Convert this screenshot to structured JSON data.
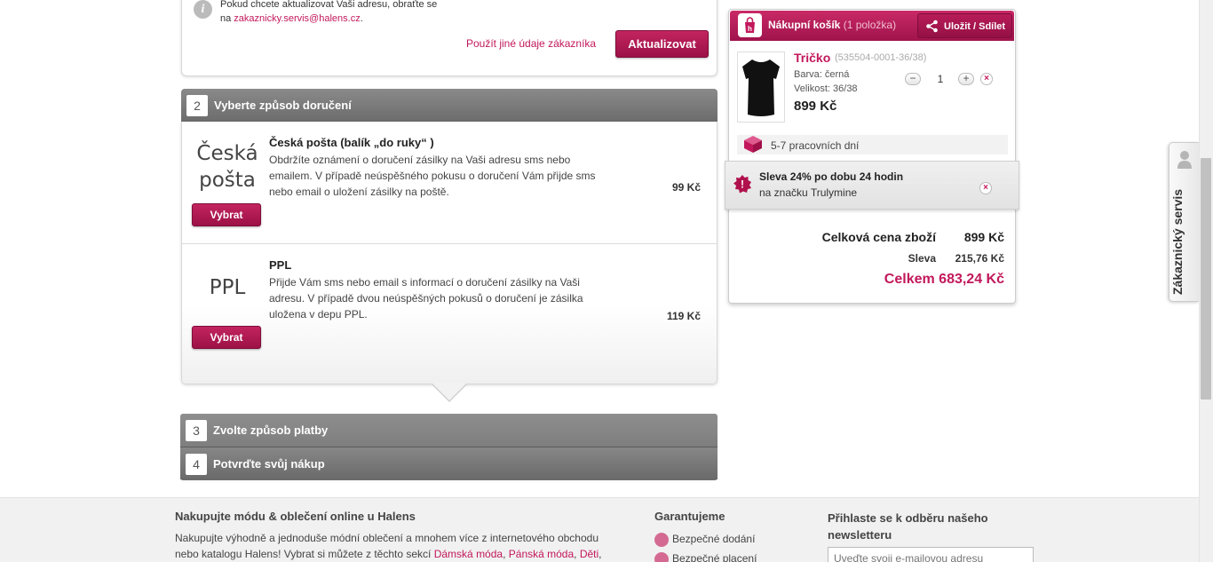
{
  "step1": {
    "info_text_line1": "Pokud chcete aktualizovat Vaši adresu, obraťte se",
    "info_text_prefix": "na ",
    "info_email": "zakaznicky.servis@halens.cz",
    "info_text_suffix": ".",
    "other_data_link": "Použít jiné údaje zákazníka",
    "update_button": "Aktualizovat"
  },
  "step2": {
    "number": "2",
    "title": "Vyberte způsob doručení",
    "options": [
      {
        "logo_line1": "Česká",
        "logo_line2": "pošta",
        "title": "Česká pošta (balík „do ruky“ )",
        "description": "Obdržíte oznámení o doručení zásilky na Vaši adresu sms nebo emailem. V případě neúspěšného pokusu o doručení Vám přijde sms nebo email o uložení zásilky na poště.",
        "price": "99 Kč",
        "button": "Vybrat"
      },
      {
        "logo_line1": "PPL",
        "title": "PPL",
        "description": "Přijde Vám sms nebo email s informací o doručení zásilky na Vaši adresu. V případě dvou neúspěšných pokusů o doručení je zásilka uložena v depu PPL.",
        "price": "119 Kč",
        "button": "Vybrat"
      }
    ]
  },
  "step3": {
    "number": "3",
    "title": "Zvolte způsob platby"
  },
  "step4": {
    "number": "4",
    "title": "Potvrďte svůj nákup"
  },
  "cart": {
    "title": "Nákupní košík",
    "count": "(1 položka)",
    "share_button": "Uložit / Sdílet",
    "item": {
      "name": "Tričko",
      "code": "(535504-0001-36/38)",
      "color": "Barva: černá",
      "size": "Velikost: 36/38",
      "price": "899 Kč",
      "quantity": "1"
    },
    "delivery_time": "5-7 pracovních dní",
    "promo_line1": "Sleva 24% po dobu 24 hodin",
    "promo_line2": "na značku Trulymine",
    "subtotal_label": "Celková cena zboží",
    "subtotal_value": "899 Kč",
    "discount_label": "Sleva",
    "discount_value": "215,76 Kč",
    "total": "Celkem 683,24 Kč"
  },
  "side_tab": {
    "label": "Zákaznický servis"
  },
  "footer": {
    "col1_heading": "Nakupujte módu & oblečení online u Halens",
    "col1_line1": "Nakupujte výhodně a jednoduše módní oblečení a mnohem více z internetového obchodu",
    "col1_line2": "nebo katalogu Halens! Vybrat si můžete z těchto sekcí ",
    "links": [
      "Dámská móda",
      "Pánská móda",
      "Děti"
    ],
    "col2_heading": "Garantujeme",
    "guarantees": [
      "Bezpečné dodání",
      "Bezpečné placení"
    ],
    "col3_heading_line1": "Přihlaste se k odběru našeho",
    "col3_heading_line2": "newsletteru",
    "newsletter_placeholder": "Uveďte svoji e-mailovou adresu"
  },
  "colors": {
    "accent": "#c2185b",
    "step_header": "#7a7a7a"
  }
}
